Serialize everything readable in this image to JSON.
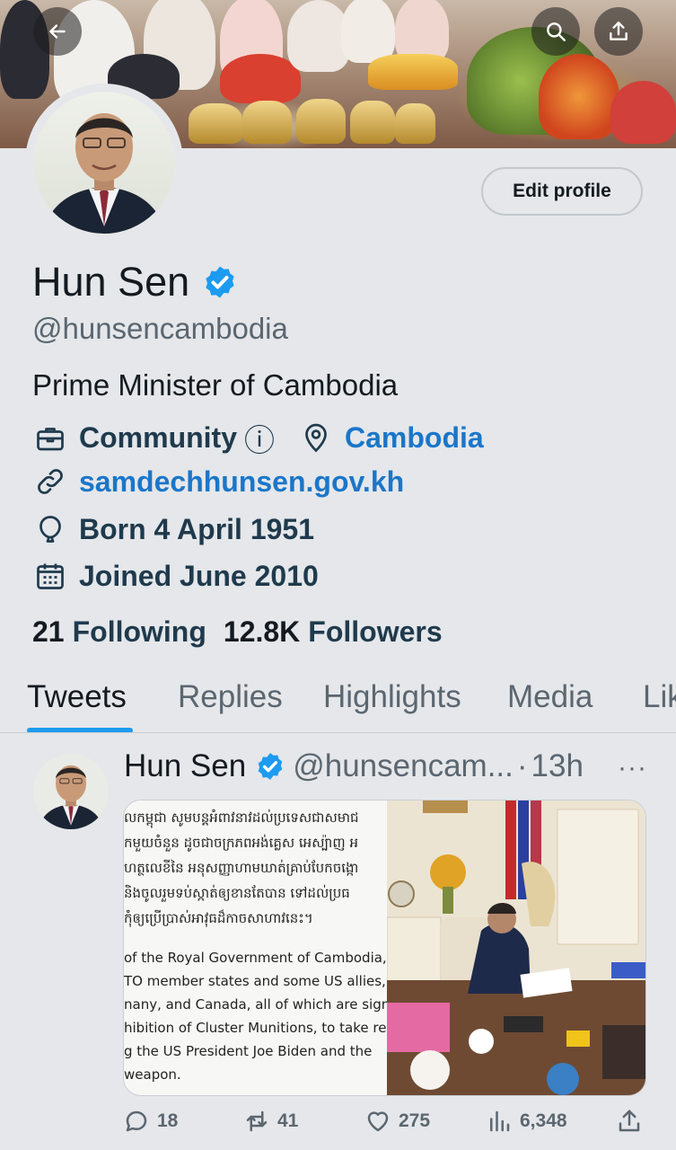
{
  "banner": {
    "back_icon": "arrow-left-icon",
    "search_icon": "search-icon",
    "share_icon": "share-icon"
  },
  "profile": {
    "edit_label": "Edit profile",
    "name": "Hun Sen",
    "handle": "@hunsencambodia",
    "bio": "Prime Minister of Cambodia",
    "category": "Community",
    "category_info": "ⓘ",
    "location": "Cambodia",
    "website": "samdechhunsen.gov.kh",
    "born": "Born 4 April 1951",
    "joined": "Joined June 2010",
    "following_count": "21",
    "following_label": "Following",
    "followers_count": "12.8K",
    "followers_label": "Followers"
  },
  "tabs": [
    {
      "label": "Tweets",
      "active": true
    },
    {
      "label": "Replies"
    },
    {
      "label": "Highlights"
    },
    {
      "label": "Media"
    },
    {
      "label": "Lik"
    }
  ],
  "tweet": {
    "name": "Hun Sen",
    "handle": "@hunsencam...",
    "dot": "·",
    "time": "13h",
    "more": "···",
    "image_text": [
      "លកម្ពុជា សូមបន្តអំពាវនាវដល់ប្រទេសជាសមាជ",
      "កមួយចំនួន ដូចជាចក្រភពអង់គ្លេស អេស្ប៉ាញ អ",
      "ហត្ថលេខីនៃ អនុសញ្ញាហាមឃាត់គ្រាប់បែកចង្កោ",
      " និងចូលរួមទប់ស្កាត់ឲ្យខានតែបាន ទៅដល់ប្រធ",
      "កុំឲ្យប្រើប្រាស់អាវុធដ៏កាចសាហាវនេះ។",
      "of the Royal Government of Cambodia,",
      "TO member states and some US allies,",
      "nany, and Canada, all of which are sign",
      "hibition of Cluster Munitions, to take res",
      "g the US President Joe Biden and the",
      "weapon."
    ],
    "replies": "18",
    "retweets": "41",
    "likes": "275",
    "views": "6,348"
  }
}
